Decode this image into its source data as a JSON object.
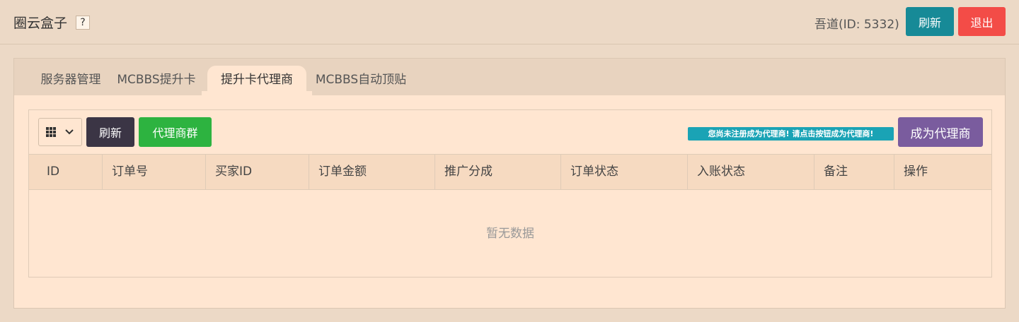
{
  "header": {
    "app_title": "圈云盒子",
    "help": "?",
    "user": "吾道(ID: 5332)",
    "refresh_label": "刷新",
    "logout_label": "退出"
  },
  "tabs": [
    {
      "label": "服务器管理",
      "active": false
    },
    {
      "label": "MCBBS提升卡",
      "active": false
    },
    {
      "label": "提升卡代理商",
      "active": true
    },
    {
      "label": "MCBBS自动顶贴",
      "active": false
    }
  ],
  "toolbar": {
    "columns_icon": "grid-icon",
    "dropdown_icon": "chevron-down-icon",
    "refresh_label": "刷新",
    "group_label": "代理商群",
    "notice": "您尚未注册成为代理商! 请点击按钮成为代理商!",
    "become_label": "成为代理商"
  },
  "table": {
    "columns": [
      "ID",
      "订单号",
      "买家ID",
      "订单金额",
      "推广分成",
      "订单状态",
      "入账状态",
      "备注",
      "操作"
    ],
    "rows": [],
    "empty_text": "暂无数据"
  },
  "colors": {
    "background": "#ecd9c6",
    "panel": "#ffe6d1",
    "refresh_teal": "#178a97",
    "logout_red": "#f34c47",
    "dark_button": "#3b3545",
    "green_button": "#2db340",
    "purple_button": "#7a5c9e",
    "notice_teal": "#1aa3b5"
  }
}
